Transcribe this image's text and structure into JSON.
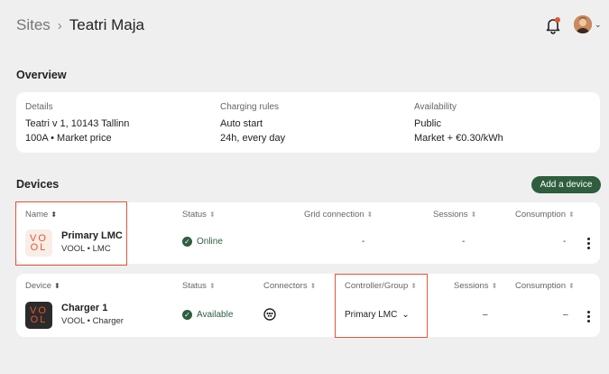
{
  "header": {
    "breadcrumb_parent": "Sites",
    "breadcrumb_sep": "›",
    "breadcrumb_current": "Teatri Maja",
    "avatar_chevron": "⌄"
  },
  "overview": {
    "title": "Overview",
    "details": {
      "label": "Details",
      "line1": "Teatri v 1, 10143 Tallinn",
      "line2": "100A • Market price"
    },
    "charging_rules": {
      "label": "Charging rules",
      "line1": "Auto start",
      "line2": "24h, every day"
    },
    "availability": {
      "label": "Availability",
      "line1": "Public",
      "line2": "Market + €0.30/kWh"
    }
  },
  "devices": {
    "title": "Devices",
    "add_button": "Add a device",
    "controllers_table": {
      "headers": {
        "name": "Name",
        "status": "Status",
        "grid": "Grid connection",
        "sessions": "Sessions",
        "consumption": "Consumption"
      },
      "row": {
        "logo_top": "VO",
        "logo_bottom": "OL",
        "name": "Primary LMC",
        "sub": "VOOL • LMC",
        "status": "Online",
        "grid": "-",
        "sessions": "-",
        "consumption": "-"
      }
    },
    "chargers_table": {
      "headers": {
        "device": "Device",
        "status": "Status",
        "connectors": "Connectors",
        "controller": "Controller/Group",
        "sessions": "Sessions",
        "consumption": "Consumption"
      },
      "row": {
        "logo_top": "VO",
        "logo_bottom": "OL",
        "name": "Charger 1",
        "sub": "VOOL • Charger",
        "status": "Available",
        "controller": "Primary LMC",
        "controller_chevron": "⌄",
        "sessions": "–",
        "consumption": "–"
      }
    },
    "sort_glyph": "⬍",
    "check_glyph": "✓"
  },
  "colors": {
    "accent": "#2e5e3e",
    "brand_orange": "#e4572e",
    "highlight": "#e0573a",
    "background": "#efefef"
  },
  "icons": [
    "bell-icon",
    "avatar",
    "chevron-down-icon",
    "sort-icon",
    "check-circle-icon",
    "connector-icon",
    "kebab-menu-icon"
  ]
}
